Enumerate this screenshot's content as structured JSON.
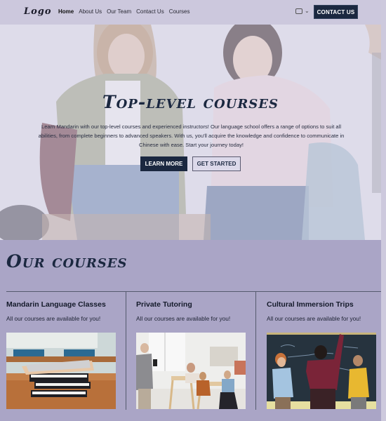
{
  "header": {
    "logo": "Logo",
    "nav": [
      {
        "label": "Home",
        "active": true
      },
      {
        "label": "About Us",
        "active": false
      },
      {
        "label": "Our Team",
        "active": false
      },
      {
        "label": "Contact Us",
        "active": false
      },
      {
        "label": "Courses",
        "active": false
      }
    ],
    "language_icon": "flag-icon",
    "contact_button": "CONTACT US"
  },
  "hero": {
    "title": "Top-level courses",
    "text": "Learn Mandarin with our top-level courses and experienced instructors! Our language school offers a range of options to suit all abilities, from complete beginners to advanced speakers. With us, you'll acquire the knowledge and confidence to communicate in Chinese with ease. Start your journey today!",
    "learn_more": "LEARN MORE",
    "get_started": "GET STARTED"
  },
  "courses": {
    "title": "Our courses",
    "items": [
      {
        "title": "Mandarin Language Classes",
        "subtitle": "All our courses are available for you!",
        "image": "books-and-tablet-on-desk"
      },
      {
        "title": "Private Tutoring",
        "subtitle": "All our courses are available for you!",
        "image": "classroom-with-teacher"
      },
      {
        "title": "Cultural Immersion Trips",
        "subtitle": "All our courses are available for you!",
        "image": "students-at-chalkboard"
      }
    ]
  },
  "colors": {
    "primary": "#1b2840",
    "background": "#aaa5c6",
    "header": "#ccc8dd"
  }
}
